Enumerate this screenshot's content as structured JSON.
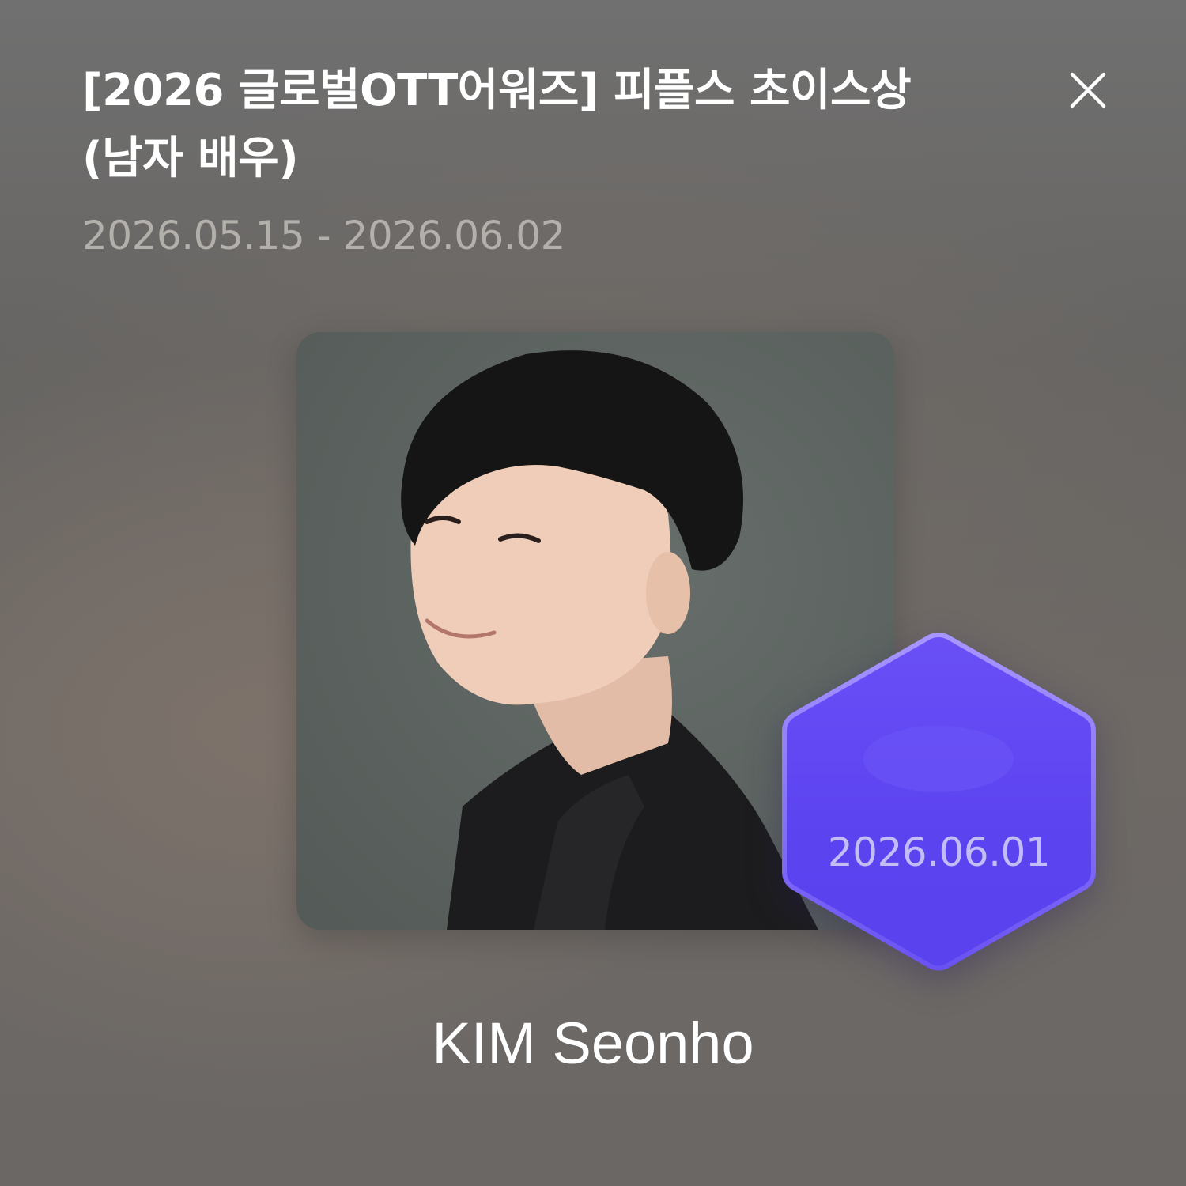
{
  "vote": {
    "title": "[2026 글로벌OTT어워즈] 피플스 초이스상 (남자 배우)",
    "period": "2026.05.15 - 2026.06.02"
  },
  "close_button": {
    "icon": "close-icon"
  },
  "candidate": {
    "name": "KIM Seonho",
    "photo_icon": "portrait-photo",
    "badge_date": "2026.06.01",
    "badge_color": "#5b43f0"
  },
  "colors": {
    "title": "#ffffff",
    "dates": "#b3afab",
    "badge": "#5b43f0",
    "badge_text": "#c4bdf5"
  }
}
